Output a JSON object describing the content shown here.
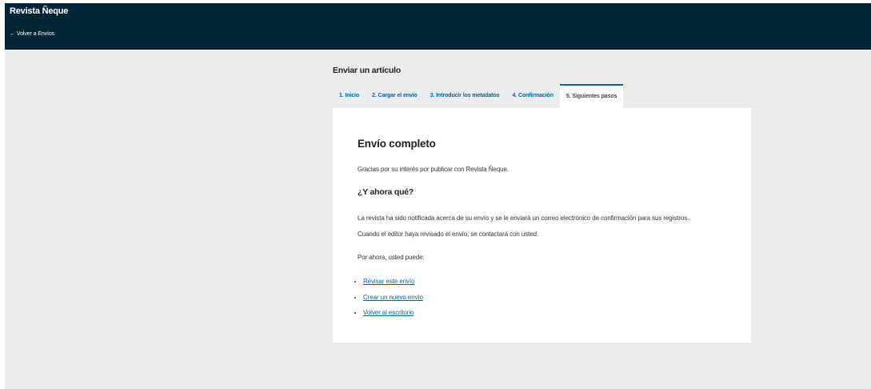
{
  "header": {
    "site_title": "Revista Ñeque",
    "back_link": "Volver a Envíos",
    "back_arrow": "←"
  },
  "page": {
    "heading": "Enviar un artículo"
  },
  "tabs": [
    {
      "label": "1. Inicio",
      "active": false
    },
    {
      "label": "2. Cargar el envío",
      "active": false
    },
    {
      "label": "3. Introducir los metadatos",
      "active": false
    },
    {
      "label": "4. Confirmación",
      "active": false
    },
    {
      "label": "5. Siguientes pasos",
      "active": true
    }
  ],
  "content": {
    "title": "Envío completo",
    "thanks": "Gracias por su interés por publicar con Revista Ñeque.",
    "subtitle": "¿Y ahora qué?",
    "notified": "La revista ha sido notificada acerca de su envío y se le enviará un correo electrónico de confirmación para sus registros.",
    "editor_contact": "Cuando el editor haya revisado el envío, se contactará con usted.",
    "for_now": "Por ahora, usted puede:",
    "links": [
      "Revisar este envío",
      "Crear un nuevo envío",
      "Volver al escritorio"
    ]
  },
  "colors": {
    "header_bg": "#022635",
    "page_bg": "#eaeced",
    "link": "#006798"
  }
}
